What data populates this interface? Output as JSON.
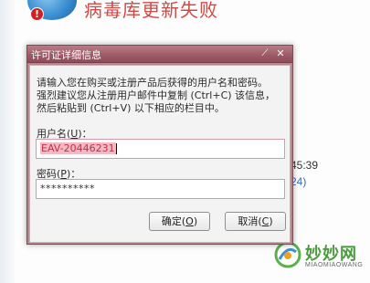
{
  "background": {
    "header_title": "病毒库更新失败",
    "alert_glyph": "!",
    "time_text": "45:39",
    "link_text": "24)"
  },
  "dialog": {
    "title": "许可证详细信息",
    "pin_glyph": "⟋",
    "close_glyph": "✕",
    "instructions": [
      "请输入您在购买或注册产品后获得的用户名和密码。",
      "强烈建议您从注册用户邮件中复制 (Ctrl+C) 该信息，",
      "然后粘贴到 (Ctrl+V) 以下相应的栏目中。"
    ],
    "username": {
      "label_prefix": "用户名(",
      "label_key": "U",
      "label_suffix": ")：",
      "value": "EAV-20446231"
    },
    "password": {
      "label_prefix": "密码(",
      "label_key": "P",
      "label_suffix": ")：",
      "value": "**********"
    },
    "ok_button": {
      "prefix": "确定(",
      "key": "O",
      "suffix": ")"
    },
    "cancel_button": {
      "prefix": "取消(",
      "key": "C",
      "suffix": ")"
    }
  },
  "watermark": {
    "name": "妙妙网",
    "sub": "MIAOMIAOWANG"
  },
  "colors": {
    "titlebar": "#9c5a66",
    "selection": "#f2b8c3",
    "brand_green": "#4a9a3f"
  }
}
